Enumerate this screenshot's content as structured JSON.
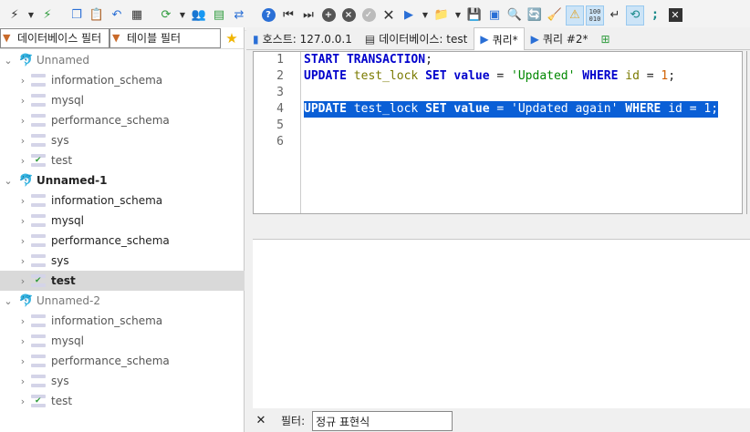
{
  "toolbar": {
    "icons": [
      "plug-icon",
      "disconnect-icon",
      "copy-icon",
      "paste-icon",
      "undo-icon",
      "print-icon",
      "refresh-icon",
      "users-icon",
      "export-icon",
      "sync-icon",
      "help-icon",
      "first-icon",
      "last-icon",
      "add-icon",
      "remove-icon",
      "apply-icon",
      "cancel-icon",
      "run-icon",
      "open-folder-icon",
      "save-icon",
      "save-as-icon",
      "search-icon",
      "replace-icon",
      "format-icon",
      "warning-icon",
      "binary-icon",
      "wrap-icon",
      "link-icon",
      "semicolon-icon",
      "close-icon"
    ]
  },
  "left_panel": {
    "db_filter_placeholder": "데이터베이스 필터",
    "table_filter_placeholder": "테이블 필터"
  },
  "tree": [
    {
      "name": "Unnamed",
      "style": "grey",
      "dbs": [
        "information_schema",
        "mysql",
        "performance_schema",
        "sys",
        "test"
      ],
      "selected": ""
    },
    {
      "name": "Unnamed-1",
      "style": "bold",
      "dbs": [
        "information_schema",
        "mysql",
        "performance_schema",
        "sys",
        "test"
      ],
      "selected": "test"
    },
    {
      "name": "Unnamed-2",
      "style": "grey",
      "dbs": [
        "information_schema",
        "mysql",
        "performance_schema",
        "sys",
        "test"
      ],
      "selected": ""
    }
  ],
  "tabs": {
    "host": "호스트: 127.0.0.1",
    "database": "데이터베이스: test",
    "query": "쿼리*",
    "query2": "쿼리 #2*"
  },
  "editor": {
    "line_numbers": [
      "1",
      "2",
      "3",
      "4",
      "5",
      "6"
    ],
    "line1": "START TRANSACTION;",
    "line2": "UPDATE test_lock SET value = 'Updated' WHERE id = 1;",
    "line3": "",
    "line4": "UPDATE test_lock SET value = 'Updated again' WHERE id = 1;",
    "line5": "",
    "line6": ""
  },
  "bottom": {
    "filter_label": "필터:",
    "filter_placeholder": "정규 표현식"
  }
}
